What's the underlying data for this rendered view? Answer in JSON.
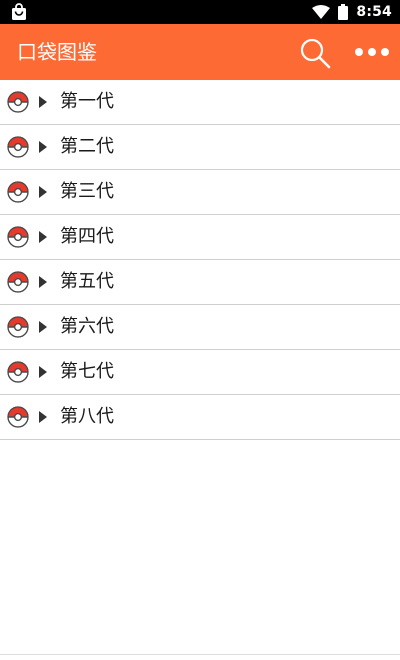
{
  "status_bar": {
    "time": "8:54",
    "left_icon": "shopping-bag-icon",
    "wifi_icon": "wifi-icon",
    "battery_icon": "battery-icon"
  },
  "app_bar": {
    "title": "口袋图鉴",
    "search_icon": "search-icon",
    "more_icon": "more-dots-icon",
    "background_color": "#fd6a34"
  },
  "list": {
    "items": [
      {
        "label": "第一代",
        "icon": "pokeball-icon"
      },
      {
        "label": "第二代",
        "icon": "pokeball-icon"
      },
      {
        "label": "第三代",
        "icon": "pokeball-icon"
      },
      {
        "label": "第四代",
        "icon": "pokeball-icon"
      },
      {
        "label": "第五代",
        "icon": "pokeball-icon"
      },
      {
        "label": "第六代",
        "icon": "pokeball-icon"
      },
      {
        "label": "第七代",
        "icon": "pokeball-icon"
      },
      {
        "label": "第八代",
        "icon": "pokeball-icon"
      }
    ]
  }
}
